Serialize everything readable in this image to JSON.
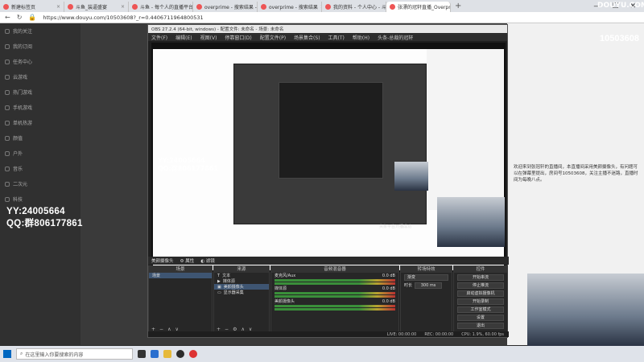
{
  "browser": {
    "tabs": [
      {
        "label": "新建标签页",
        "active": false
      },
      {
        "label": "斗鱼_装逼盛宴",
        "active": false
      },
      {
        "label": "斗鱼 - 每个人的直播平台",
        "active": false
      },
      {
        "label": "overprime - 搜索结果 - 斗鱼直播",
        "active": false
      },
      {
        "label": "overprime - 搜索结果",
        "active": false
      },
      {
        "label": "我的资料 - 个人中心 - 斗鱼",
        "active": false
      },
      {
        "label": "张漂的冠轩直播_Overprime遛狗",
        "active": true
      }
    ],
    "new_tab": "+",
    "url": "https://www.douyu.com/10503608?_r=0.4406711964800531"
  },
  "douyu": {
    "logo": "DOUYU.COM",
    "room_id": "10503608",
    "sidebar": [
      "我的关注",
      "我的订阅",
      "任务中心",
      "云游戏",
      "热门游戏",
      "手机游戏",
      "单机热游",
      "颜值",
      "户外",
      "音乐",
      "二次元",
      "科技"
    ]
  },
  "obs": {
    "title": "OBS 27.2.4 (64-bit, windows) - 配置文件: 未命名 - 场景: 未命名",
    "menu": [
      "文件(F)",
      "编辑(E)",
      "视图(V)",
      "停靠窗口(D)",
      "配置文件(P)",
      "场景集合(S)",
      "工具(T)",
      "帮助(H)",
      "头条-总裁的冠轩"
    ],
    "toolbar": {
      "source_label": "美颜摄像头",
      "properties": "属性",
      "filters": "滤镜"
    },
    "docks": {
      "scenes": {
        "title": "场景",
        "items": [
          "场景"
        ]
      },
      "sources": {
        "title": "来源",
        "items": [
          "文本",
          "媒体源",
          "美颜摄像头",
          "显示器采集"
        ]
      },
      "mixer": {
        "title": "音频混音器",
        "channels": [
          {
            "name": "麦克风/Aux",
            "db": "0.0 dB"
          },
          {
            "name": "媒体源",
            "db": "0.0 dB"
          },
          {
            "name": "美颜摄像头",
            "db": "0.0 dB"
          }
        ]
      },
      "transitions": {
        "title": "转场特效",
        "type": "渐变",
        "duration_label": "时长",
        "duration": "300 ms"
      },
      "controls": {
        "title": "控件",
        "buttons": [
          "开始串流",
          "停止推流",
          "启动虚拟摄像机",
          "开始录制",
          "工作室模式",
          "设置",
          "退出"
        ]
      }
    },
    "status": {
      "live": "LIVE: 00:00:00",
      "rec": "REC: 00:00:00",
      "cpu": "CPU: 1.9%, 60.00 fps"
    }
  },
  "overlay": {
    "small": [
      "YY:24005664",
      "QQ:群806177861"
    ],
    "big": [
      "YY:24005664",
      "QQ:群806177861"
    ],
    "toast": "头条平台开播成功"
  },
  "chat_text": "欢迎来到张冠轩的直播间，本直播间采用美颜摄像头，有问题可以在弹幕里提出，房间号10503608，关注主播不迷路，直播时间为每晚八点。",
  "taskbar": {
    "search_placeholder": "在这里输入你要搜索的内容"
  }
}
